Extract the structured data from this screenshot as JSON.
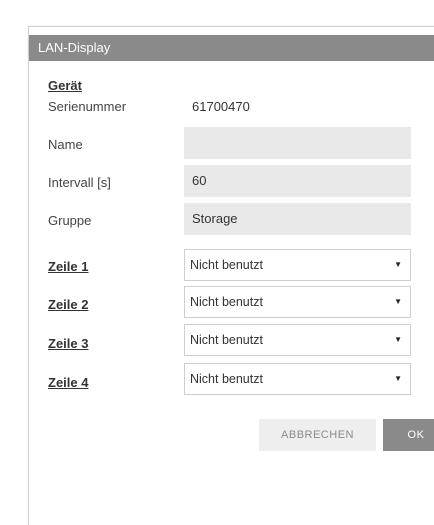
{
  "dialog": {
    "title": "LAN-Display"
  },
  "device": {
    "heading": "Gerät",
    "serial_label": "Serienummer",
    "serial_value": "61700470",
    "name_label": "Name",
    "name_value": "",
    "interval_label": "Intervall [s]",
    "interval_value": "60",
    "group_label": "Gruppe",
    "group_value": "Storage"
  },
  "lines": [
    {
      "label": "Zeile 1",
      "selected": "Nicht benutzt"
    },
    {
      "label": "Zeile 2",
      "selected": "Nicht benutzt"
    },
    {
      "label": "Zeile 3",
      "selected": "Nicht benutzt"
    },
    {
      "label": "Zeile 4",
      "selected": "Nicht benutzt"
    }
  ],
  "buttons": {
    "cancel_label": "ABBRECHEN",
    "ok_label": "OK"
  },
  "colors": {
    "titlebar": "#8a8a8a",
    "field_background": "#e9e9e9",
    "ok_button": "#8a8a8a",
    "cancel_button": "#eeeeee"
  },
  "icons": {
    "dropdown": "caret-down-icon"
  }
}
